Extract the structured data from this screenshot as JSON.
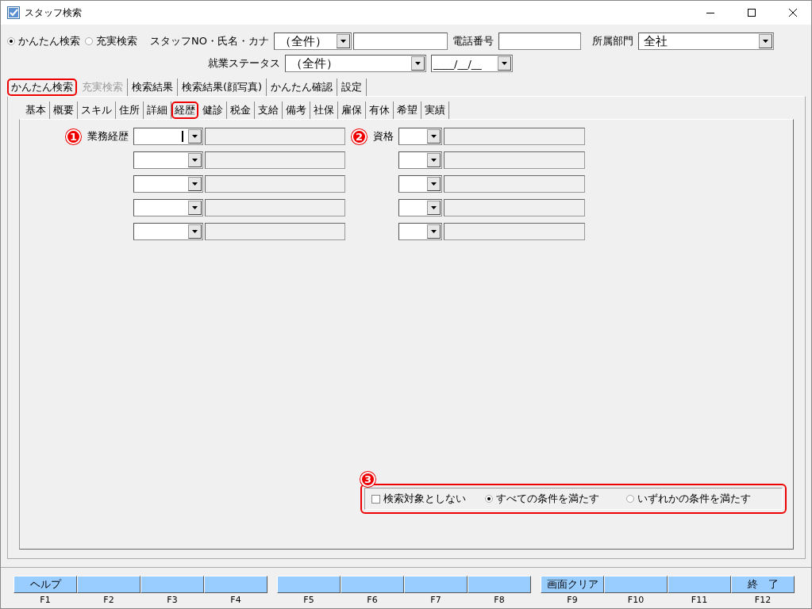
{
  "window": {
    "title": "スタッフ検索"
  },
  "search_mode": [
    {
      "label": "かんたん検索",
      "selected": true
    },
    {
      "label": "充実検索",
      "selected": false
    }
  ],
  "staff_no": {
    "label": "スタッフNO・氏名・カナ",
    "value": "（全件）"
  },
  "phone": {
    "label": "電話番号"
  },
  "department": {
    "label": "所属部門",
    "value": "全社"
  },
  "employment_status": {
    "label": "就業ステータス",
    "value": "（全件）",
    "date": "____/__/__"
  },
  "tabs": [
    {
      "label": "かんたん検索",
      "disabled": false,
      "highlighted": true
    },
    {
      "label": "充実検索",
      "disabled": true,
      "highlighted": false
    },
    {
      "label": "検索結果",
      "disabled": false,
      "highlighted": false
    },
    {
      "label": "検索結果(顔写真)",
      "disabled": false,
      "highlighted": false
    },
    {
      "label": "かんたん確認",
      "disabled": false,
      "highlighted": false
    },
    {
      "label": "設定",
      "disabled": false,
      "highlighted": false
    }
  ],
  "subtabs": [
    {
      "label": "基本",
      "highlighted": false
    },
    {
      "label": "概要",
      "highlighted": false
    },
    {
      "label": "スキル",
      "highlighted": false
    },
    {
      "label": "住所",
      "highlighted": false
    },
    {
      "label": "詳細",
      "highlighted": false
    },
    {
      "label": "経歴",
      "highlighted": true
    },
    {
      "label": "健診",
      "highlighted": false
    },
    {
      "label": "税金",
      "highlighted": false
    },
    {
      "label": "支給",
      "highlighted": false
    },
    {
      "label": "備考",
      "highlighted": false
    },
    {
      "label": "社保",
      "highlighted": false
    },
    {
      "label": "雇保",
      "highlighted": false
    },
    {
      "label": "有休",
      "highlighted": false
    },
    {
      "label": "希望",
      "highlighted": false
    },
    {
      "label": "実績",
      "highlighted": false
    }
  ],
  "career": {
    "marker": "1",
    "label": "業務経歴",
    "rows": [
      {
        "focused": true
      },
      {
        "focused": false
      },
      {
        "focused": false
      },
      {
        "focused": false
      },
      {
        "focused": false
      }
    ]
  },
  "qualification": {
    "marker": "2",
    "label": "資格",
    "rows": [
      {
        "focused": false
      },
      {
        "focused": false
      },
      {
        "focused": false
      },
      {
        "focused": false
      },
      {
        "focused": false
      }
    ]
  },
  "conditions": {
    "marker": "3",
    "highlighted": true,
    "exclude": {
      "label": "検索対象としない",
      "checked": false
    },
    "match": [
      {
        "label": "すべての条件を満たす",
        "selected": true
      },
      {
        "label": "いずれかの条件を満たす",
        "selected": false
      }
    ]
  },
  "function_keys": [
    {
      "label": "ヘルプ",
      "key": "F1"
    },
    {
      "key": "F2"
    },
    {
      "key": "F3"
    },
    {
      "key": "F4"
    },
    {
      "key": "F5"
    },
    {
      "key": "F6"
    },
    {
      "key": "F7"
    },
    {
      "key": "F8"
    },
    {
      "label": "画面クリア",
      "key": "F9"
    },
    {
      "key": "F10"
    },
    {
      "key": "F11"
    },
    {
      "label": "終　了",
      "key": "F12"
    }
  ]
}
